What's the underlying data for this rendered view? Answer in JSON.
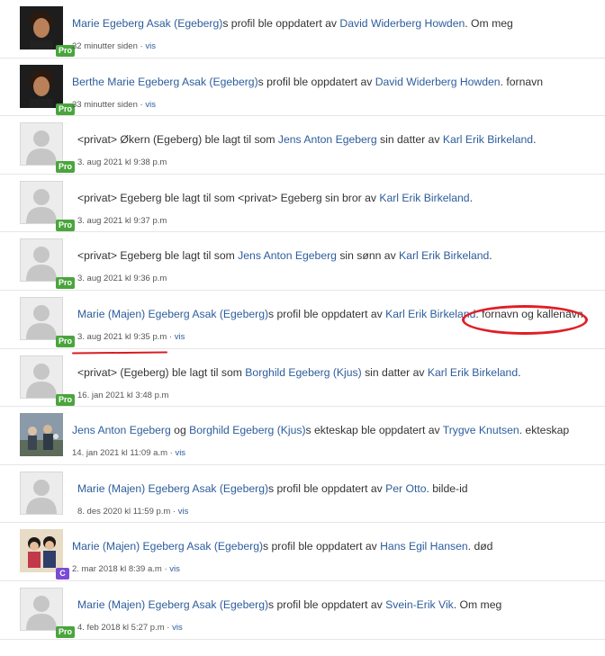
{
  "colors": {
    "link": "#2d5d9c",
    "pro_badge": "#4aa53d",
    "c_badge": "#7b4ad6",
    "annotation": "#e01e25"
  },
  "badges": {
    "pro": "Pro",
    "c": "C"
  },
  "vis_label": "vis",
  "items": [
    {
      "avatar": "dark-haired-person-photo",
      "badge": "Pro",
      "parts": [
        "Marie Egeberg Asak (Egeberg)",
        "s profil ble oppdatert av ",
        "David Widerberg Howden",
        ". Om meg"
      ],
      "time": "32 minutter siden"
    },
    {
      "avatar": "dark-haired-person-photo",
      "badge": "Pro",
      "parts": [
        "Berthe Marie Egeberg Asak (Egeberg)",
        "s profil ble oppdatert av ",
        "David Widerberg Howden",
        ". fornavn"
      ],
      "time": "33 minutter siden"
    },
    {
      "avatar": "silhouette",
      "badge": "Pro",
      "parts": [
        "<privat> Økern (Egeberg) ble lagt til som ",
        "Jens Anton Egeberg",
        " sin datter av ",
        "Karl Erik Birkeland",
        "."
      ],
      "time": "3. aug 2021 kl 9:38 p.m"
    },
    {
      "avatar": "silhouette",
      "badge": "Pro",
      "parts": [
        "<privat> Egeberg ble lagt til som <privat> Egeberg sin bror av ",
        "Karl Erik Birkeland",
        "."
      ],
      "time": "3. aug 2021 kl 9:37 p.m"
    },
    {
      "avatar": "silhouette",
      "badge": "Pro",
      "parts": [
        "<privat> Egeberg ble lagt til som ",
        "Jens Anton Egeberg",
        " sin sønn av ",
        "Karl Erik Birkeland",
        "."
      ],
      "time": "3. aug 2021 kl 9:36 p.m"
    },
    {
      "avatar": "silhouette",
      "badge": "Pro",
      "parts": [
        "Marie (Majen) Egeberg Asak (Egeberg)",
        "s profil ble oppdatert av ",
        "Karl Erik Birkeland",
        ". fornavn og kallenavn"
      ],
      "time": "3. aug 2021 kl 9:35 p.m"
    },
    {
      "avatar": "silhouette",
      "badge": "Pro",
      "parts": [
        "<privat> (Egeberg) ble lagt til som ",
        "Borghild Egeberg (Kjus)",
        " sin datter av ",
        "Karl Erik Birkeland",
        "."
      ],
      "time": "16. jan 2021 kl 3:48 p.m"
    },
    {
      "avatar": "outdoor-family-photo",
      "badge": "",
      "parts": [
        "Jens Anton Egeberg",
        " og ",
        "Borghild Egeberg (Kjus)",
        "s ekteskap ble oppdatert av ",
        "Trygve Knutsen",
        ". ekteskap"
      ],
      "time": "14. jan 2021 kl 11:09 a.m"
    },
    {
      "avatar": "silhouette",
      "badge": "",
      "parts": [
        "Marie (Majen) Egeberg Asak (Egeberg)",
        "s profil ble oppdatert av ",
        "Per Otto",
        ". bilde-id"
      ],
      "time": "8. des 2020 kl 11:59 p.m"
    },
    {
      "avatar": "couple-photo",
      "badge": "C",
      "parts": [
        "Marie (Majen) Egeberg Asak (Egeberg)",
        "s profil ble oppdatert av ",
        "Hans Egil Hansen",
        ". død"
      ],
      "time": "2. mar 2018 kl 8:39 a.m"
    },
    {
      "avatar": "silhouette",
      "badge": "Pro",
      "parts": [
        "Marie (Majen) Egeberg Asak (Egeberg)",
        "s profil ble oppdatert av ",
        "Svein-Erik Vik",
        ". Om meg"
      ],
      "time": "4. feb 2018 kl 5:27 p.m"
    }
  ]
}
